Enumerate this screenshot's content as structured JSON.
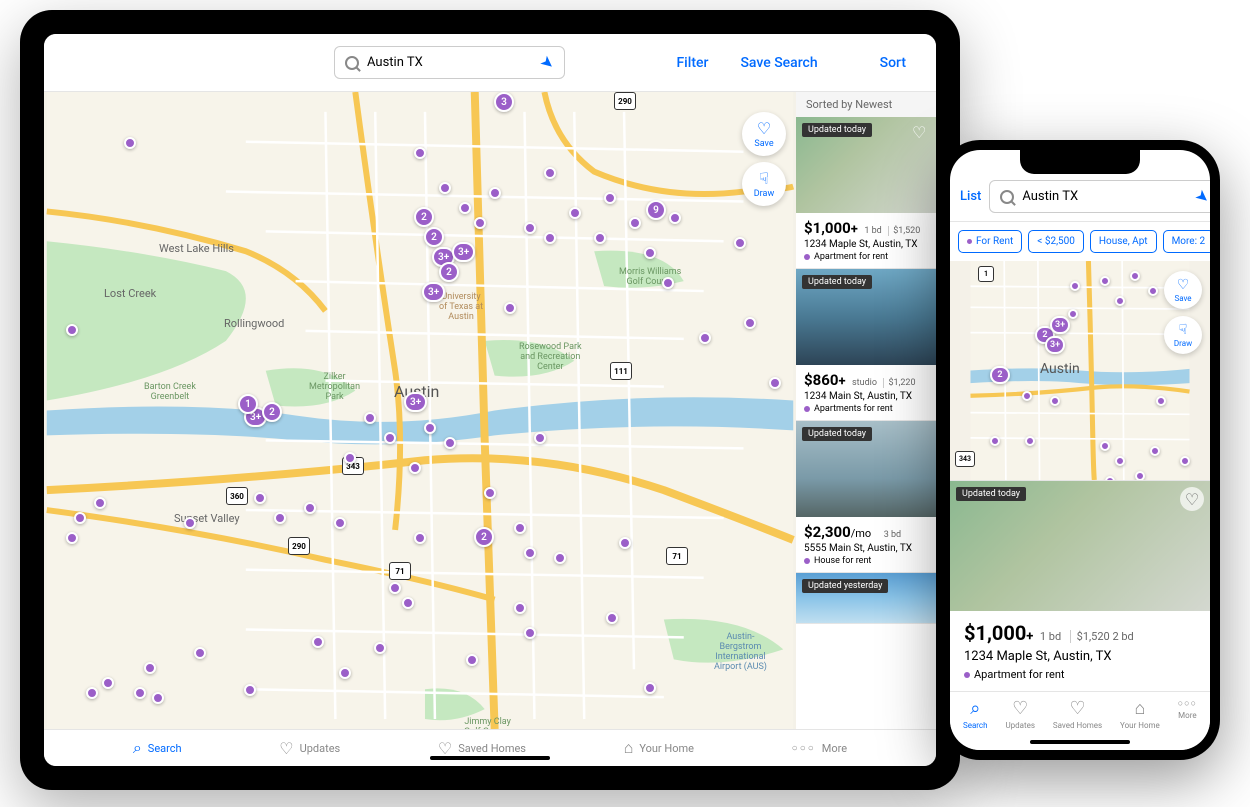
{
  "ipad": {
    "search_value": "Austin TX",
    "filter_btn": "Filter",
    "save_search_btn": "Save Search",
    "sort_btn": "Sort",
    "sorted_by": "Sorted by Newest",
    "map_controls": {
      "save": "Save",
      "draw": "Draw"
    },
    "nav": {
      "search": "Search",
      "updates": "Updates",
      "saved_homes": "Saved Homes",
      "your_home": "Your Home",
      "more": "More"
    },
    "map_labels": {
      "city": "Austin",
      "west_lake_hills": "West Lake Hills",
      "lost_creek": "Lost Creek",
      "rollingwood": "Rollingwood",
      "sunset_valley": "Sunset Valley",
      "barton_creek": "Barton Creek\nGreenbelt",
      "zilker_park": "Zilker\nMetropolitan\nPark",
      "rosewood": "Rosewood Park\nand Recreation\nCenter",
      "morris_williams": "Morris Williams\nGolf Course",
      "jimmy_clay": "Jimmy Clay\nGolf Course",
      "airport": "Austin-\nBergstrom\nInternational\nAirport (AUS)",
      "ut_austin": "University\nof Texas at\nAustin"
    },
    "listings": [
      {
        "badge": "Updated today",
        "price": "$1,000",
        "plus": "+",
        "sub1": "1 bd",
        "sub2": "$1,520",
        "addr": "1234 Maple St, Austin, TX",
        "type": "Apartment for rent",
        "img": "green"
      },
      {
        "badge": "Updated today",
        "price": "$860",
        "plus": "+",
        "sub1": "studio",
        "sub2": "$1,220",
        "addr": "1234 Main St, Austin, TX",
        "type": "Apartments for rent",
        "img": "bldg"
      },
      {
        "badge": "Updated today",
        "price": "$2,300",
        "plus": "/mo",
        "sub1": "3 bd",
        "sub2": "",
        "addr": "5555 Main St, Austin, TX",
        "type": "House for rent",
        "img": "house"
      },
      {
        "badge": "Updated yesterday",
        "price": "",
        "plus": "",
        "sub1": "",
        "sub2": "",
        "addr": "",
        "type": "",
        "img": "sky"
      }
    ]
  },
  "iphone": {
    "list_btn": "List",
    "search_value": "Austin TX",
    "chips": [
      {
        "label": "For Rent",
        "dot": true
      },
      {
        "label": "< $2,500",
        "dot": false
      },
      {
        "label": "House, Apt",
        "dot": false
      },
      {
        "label": "More: 2",
        "dot": false
      }
    ],
    "map_controls": {
      "save": "Save",
      "draw": "Draw"
    },
    "card": {
      "badge": "Updated today",
      "price": "$1,000",
      "plus": "+",
      "sub1": "1 bd",
      "sub2": "$1,520 2 bd",
      "addr": "1234 Maple St, Austin, TX",
      "type": "Apartment for rent"
    },
    "nav": {
      "search": "Search",
      "updates": "Updates",
      "saved_homes": "Saved Homes",
      "your_home": "Your Home",
      "more": "More"
    }
  }
}
